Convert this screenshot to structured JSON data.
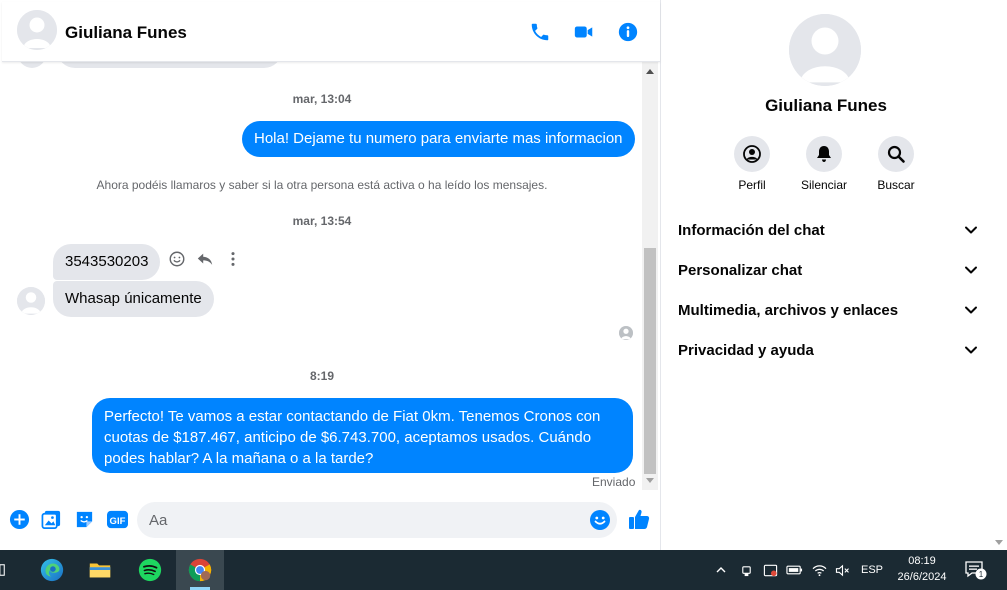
{
  "chat": {
    "contact_name": "Giuliana Funes",
    "messages": [
      {
        "type": "timestamp",
        "text": "mar, 13:04"
      },
      {
        "type": "outgoing",
        "text": "Hola! Dejame tu numero para enviarte mas informacion"
      },
      {
        "type": "system",
        "text": "Ahora podéis llamaros y saber si la otra persona está activa o ha leído los mensajes."
      },
      {
        "type": "timestamp",
        "text": "mar, 13:54"
      },
      {
        "type": "incoming",
        "text": "3543530203"
      },
      {
        "type": "incoming",
        "text": "Whasap únicamente"
      },
      {
        "type": "timestamp",
        "text": "8:19"
      },
      {
        "type": "outgoing",
        "text": "Perfecto! Te vamos a estar contactando de Fiat 0km. Tenemos Cronos con cuotas de $187.467, anticipo de $6.743.700, aceptamos usados. Cuándo podes hablar? A la mañana o a la tarde?"
      }
    ],
    "status": "Enviado",
    "composer_placeholder": "Aa",
    "composer_gif": "GIF"
  },
  "sidebar": {
    "name": "Giuliana Funes",
    "actions": [
      {
        "label": "Perfil",
        "icon": "profile-icon"
      },
      {
        "label": "Silenciar",
        "icon": "bell-icon"
      },
      {
        "label": "Buscar",
        "icon": "search-icon"
      }
    ],
    "sections": [
      {
        "label": "Información del chat"
      },
      {
        "label": "Personalizar chat"
      },
      {
        "label": "Multimedia, archivos y enlaces"
      },
      {
        "label": "Privacidad y ayuda"
      }
    ]
  },
  "taskbar": {
    "language": "ESP",
    "time": "08:19",
    "date": "26/6/2024",
    "notifications": "1"
  },
  "colors": {
    "accent": "#0084ff",
    "bubble_in": "#e4e6eb",
    "taskbar": "#1b2a33"
  }
}
